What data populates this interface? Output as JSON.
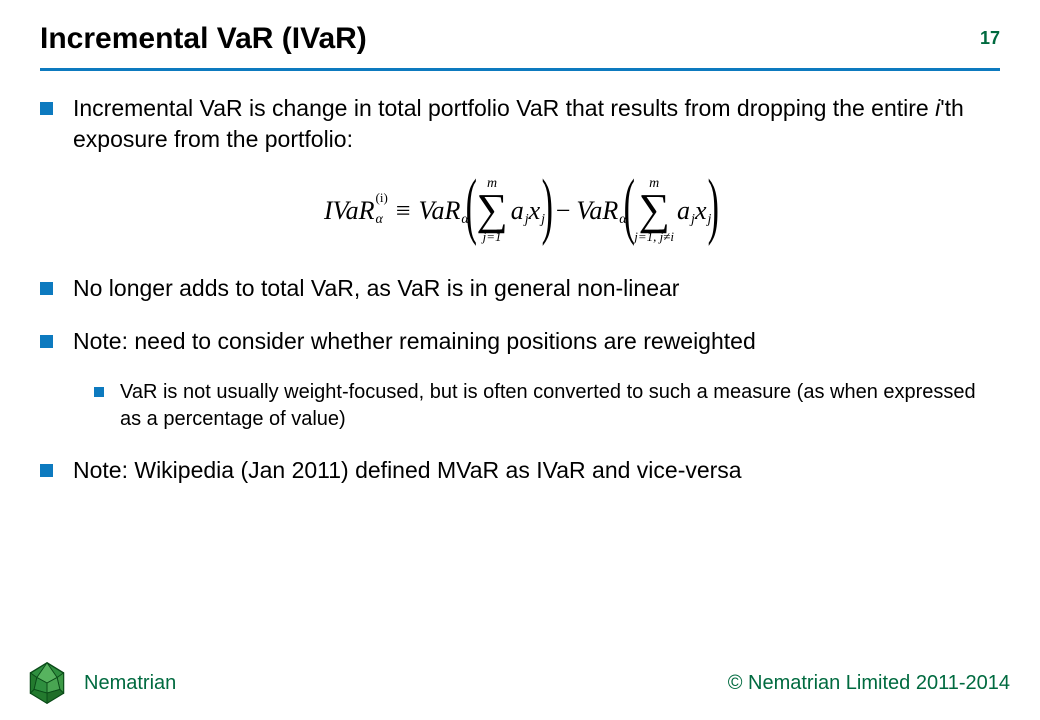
{
  "title": "Incremental VaR (IVaR)",
  "page_number": "17",
  "bullets": {
    "b1": {
      "pre": "Incremental VaR is change in total portfolio VaR that results from dropping the entire ",
      "ital": "i",
      "post": "'th exposure from the portfolio:"
    },
    "b2": "No longer adds to total VaR, as VaR is in general non-linear",
    "b3": "Note: need to consider whether remaining positions are reweighted",
    "b3a": "VaR is not usually weight-focused, but is often converted to such a measure (as when expressed as a percentage of value)",
    "b4": "Note: Wikipedia (Jan 2011) defined MVaR as IVaR and vice-versa"
  },
  "formula": {
    "lhs_sym": "IVaR",
    "lhs_sub": "α",
    "lhs_sup": "(i)",
    "equiv": "≡",
    "var_sym": "VaR",
    "var_sub": "α",
    "sum_top": "m",
    "sum1_bot": "j=1",
    "sum2_bot": "j=1, j≠i",
    "term_a": "a",
    "term_x": "x",
    "term_sub": "j",
    "minus": "−"
  },
  "footer": {
    "brand": "Nematrian",
    "copyright": "© Nematrian Limited 2011-2014"
  },
  "colors": {
    "accent": "#0d7abf",
    "brand": "#006a3f"
  }
}
